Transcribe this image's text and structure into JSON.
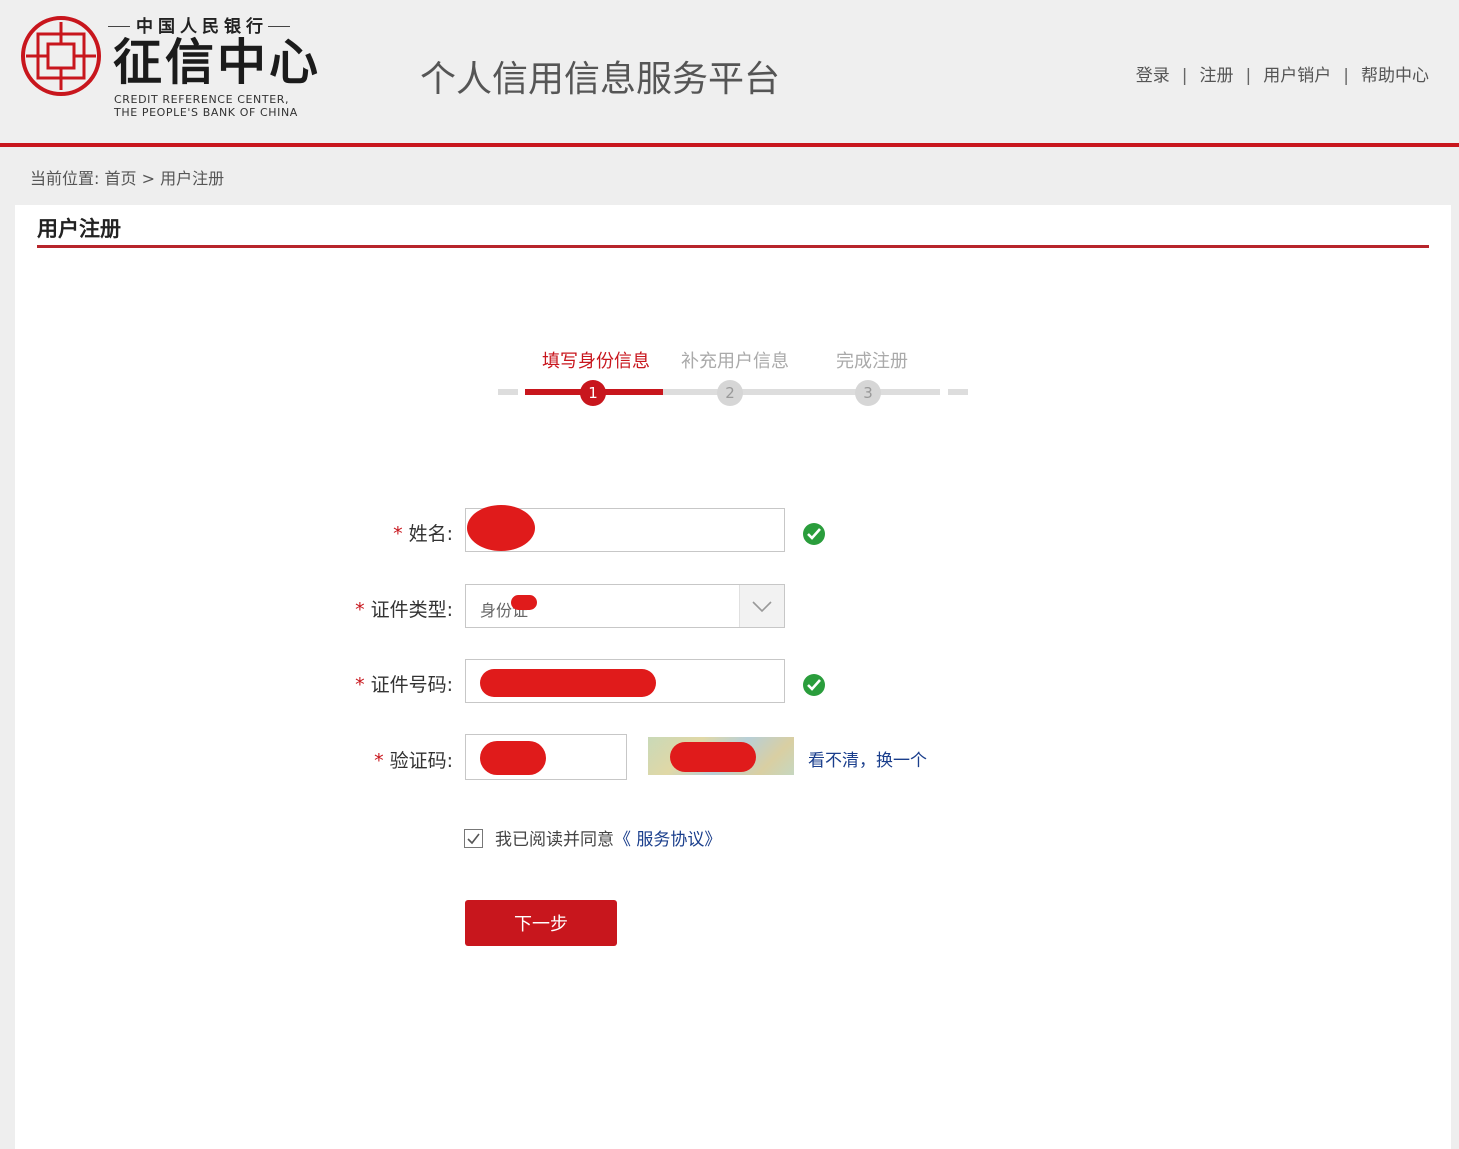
{
  "header": {
    "logo_top": "中国人民银行",
    "logo_main": "征信中心",
    "logo_en_line1": "CREDIT REFERENCE CENTER,",
    "logo_en_line2": "THE PEOPLE'S BANK OF CHINA",
    "platform_title": "个人信用信息服务平台",
    "nav": [
      "登录",
      "注册",
      "用户销户",
      "帮助中心"
    ],
    "separator": "|"
  },
  "breadcrumb": {
    "prefix": "当前位置:",
    "home": "首页",
    "arrow": ">",
    "current": "用户注册"
  },
  "panel": {
    "title": "用户注册"
  },
  "steps": [
    {
      "label": "填写身份信息",
      "number": "1",
      "state": "active"
    },
    {
      "label": "补充用户信息",
      "number": "2",
      "state": "inactive"
    },
    {
      "label": "完成注册",
      "number": "3",
      "state": "inactive"
    }
  ],
  "form": {
    "required_mark": "*",
    "name_label": "姓名:",
    "id_type_label": "证件类型:",
    "id_type_value": "身份证",
    "id_number_label": "证件号码:",
    "captcha_label": "验证码:",
    "captcha_refresh": "看不清，换一个",
    "agree_text": "我已阅读并同意",
    "agree_link": "《 服务协议》",
    "next_button": "下一步"
  },
  "colors": {
    "accent": "#c8161d",
    "link": "#1a3e8c",
    "success": "#2a9d3c",
    "redaction": "#e01b1b"
  },
  "icons": [
    "seal-logo-icon",
    "check-circle-icon",
    "chevron-down-icon",
    "checkbox-check-icon"
  ]
}
